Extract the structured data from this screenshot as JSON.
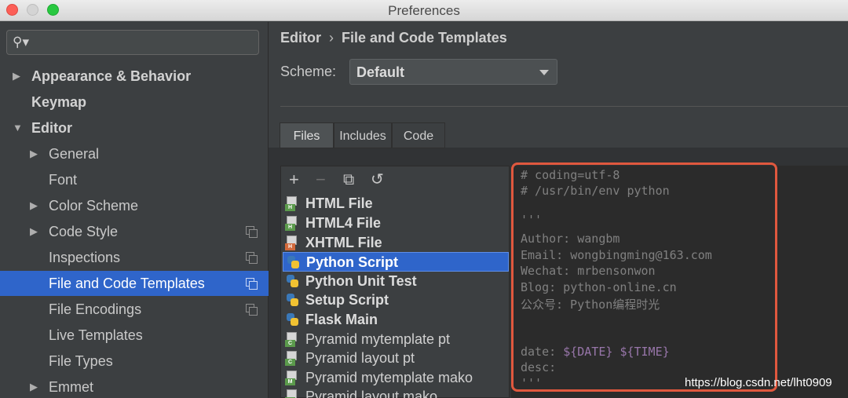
{
  "window": {
    "title": "Preferences"
  },
  "search": {
    "placeholder": ""
  },
  "sidebar": {
    "items": [
      {
        "label": "Appearance & Behavior"
      },
      {
        "label": "Keymap"
      },
      {
        "label": "Editor"
      },
      {
        "label": "General"
      },
      {
        "label": "Font"
      },
      {
        "label": "Color Scheme"
      },
      {
        "label": "Code Style"
      },
      {
        "label": "Inspections"
      },
      {
        "label": "File and Code Templates"
      },
      {
        "label": "File Encodings"
      },
      {
        "label": "Live Templates"
      },
      {
        "label": "File Types"
      },
      {
        "label": "Emmet"
      }
    ]
  },
  "breadcrumb": {
    "parent": "Editor",
    "separator": "›",
    "current": "File and Code Templates"
  },
  "scheme": {
    "label": "Scheme:",
    "value": "Default"
  },
  "tabs": [
    {
      "label": "Files"
    },
    {
      "label": "Includes"
    },
    {
      "label": "Code"
    }
  ],
  "toolbar": {
    "add": "+",
    "remove": "−",
    "copy": "⧉",
    "reset": "↺"
  },
  "templates": [
    {
      "label": "HTML File",
      "icon_tag": "H",
      "tag_color": "#5b9a4c"
    },
    {
      "label": "HTML4 File",
      "icon_tag": "H",
      "tag_color": "#5b9a4c"
    },
    {
      "label": "XHTML File",
      "icon_tag": "H",
      "tag_color": "#d2693b"
    },
    {
      "label": "Python Script"
    },
    {
      "label": "Python Unit Test"
    },
    {
      "label": "Setup Script"
    },
    {
      "label": "Flask Main"
    },
    {
      "label": "Pyramid mytemplate pt",
      "icon_tag": "C",
      "tag_color": "#5b9a4c"
    },
    {
      "label": "Pyramid layout pt",
      "icon_tag": "C",
      "tag_color": "#5b9a4c"
    },
    {
      "label": "Pyramid mytemplate mako",
      "icon_tag": "M",
      "tag_color": "#5b9a4c"
    },
    {
      "label": "Pyramid layout mako",
      "icon_tag": "M",
      "tag_color": "#5b9a4c"
    }
  ],
  "code": {
    "line1": "# coding=utf-8",
    "line2": "# /usr/bin/env python",
    "line3": "'''",
    "line4": "Author: wangbm",
    "line5": "Email: wongbingming@163.com",
    "line6": "Wechat: mrbensonwon",
    "line7": "Blog: python-online.cn",
    "line8": "公众号: Python编程时光",
    "line9_prefix": "date: ",
    "line9_date": "${DATE}",
    "line9_time": "${TIME}",
    "line10": "desc:",
    "line11": "'''"
  },
  "watermark": "https://blog.csdn.net/lht0909",
  "colors": {
    "selection": "#2f65ca",
    "highlight_border": "#e0583e",
    "template_variable": "#9876aa"
  }
}
